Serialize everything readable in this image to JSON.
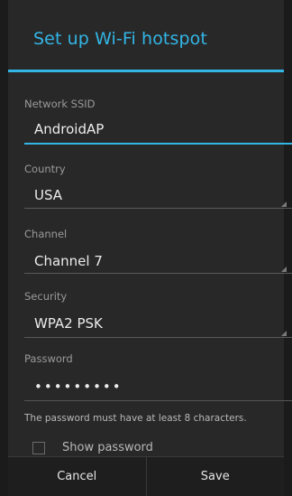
{
  "dialog": {
    "title": "Set up Wi-Fi hotspot",
    "accent_color": "#33b5e5"
  },
  "fields": {
    "ssid": {
      "label": "Network SSID",
      "value": "AndroidAP"
    },
    "country": {
      "label": "Country",
      "value": "USA"
    },
    "channel": {
      "label": "Channel",
      "value": "Channel 7"
    },
    "security": {
      "label": "Security",
      "value": "WPA2 PSK"
    },
    "password": {
      "label": "Password",
      "value": "•••••••••"
    }
  },
  "helper_text": "The password must have at least 8 characters.",
  "show_password": {
    "label": "Show password",
    "checked": false
  },
  "buttons": {
    "cancel": "Cancel",
    "save": "Save"
  }
}
